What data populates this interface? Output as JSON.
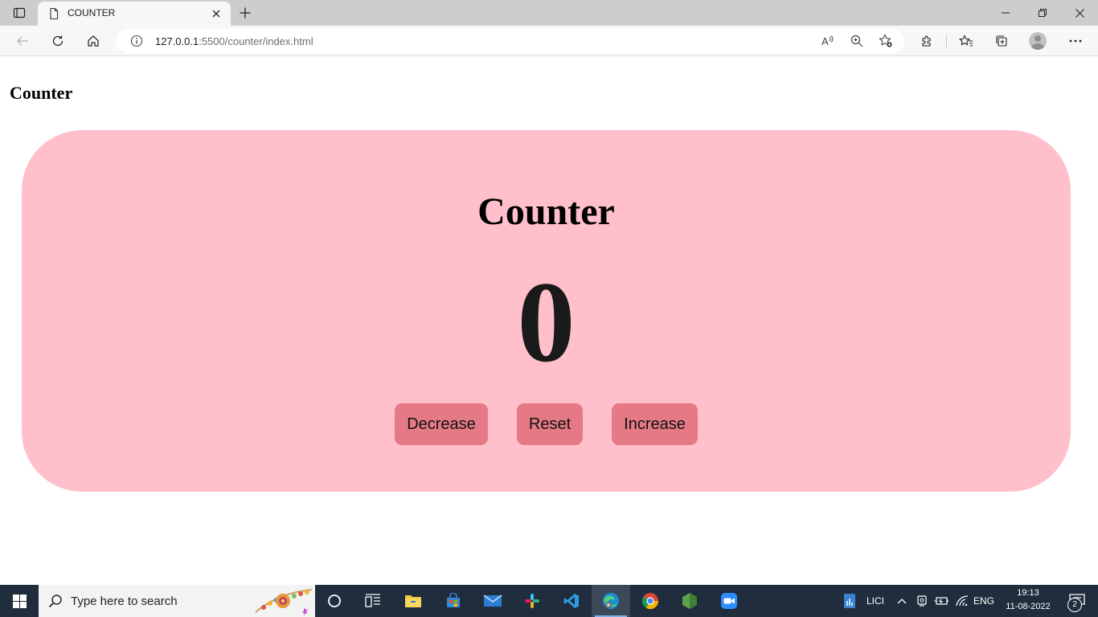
{
  "browser": {
    "tab": {
      "title": "COUNTER"
    },
    "address": {
      "host": "127.0.0.1",
      "path": ":5500/counter/index.html"
    }
  },
  "page": {
    "heading": "Counter",
    "card": {
      "title": "Counter",
      "value": "0",
      "buttons": {
        "decrease": "Decrease",
        "reset": "Reset",
        "increase": "Increase"
      },
      "card_color": "#ffc0cb",
      "button_color": "#e57985"
    }
  },
  "taskbar": {
    "search_placeholder": "Type here to search",
    "tray": {
      "widget_label": "LICI",
      "language": "ENG"
    },
    "clock": {
      "time": "19:13",
      "date": "11-08-2022"
    },
    "notification_count": "2"
  }
}
